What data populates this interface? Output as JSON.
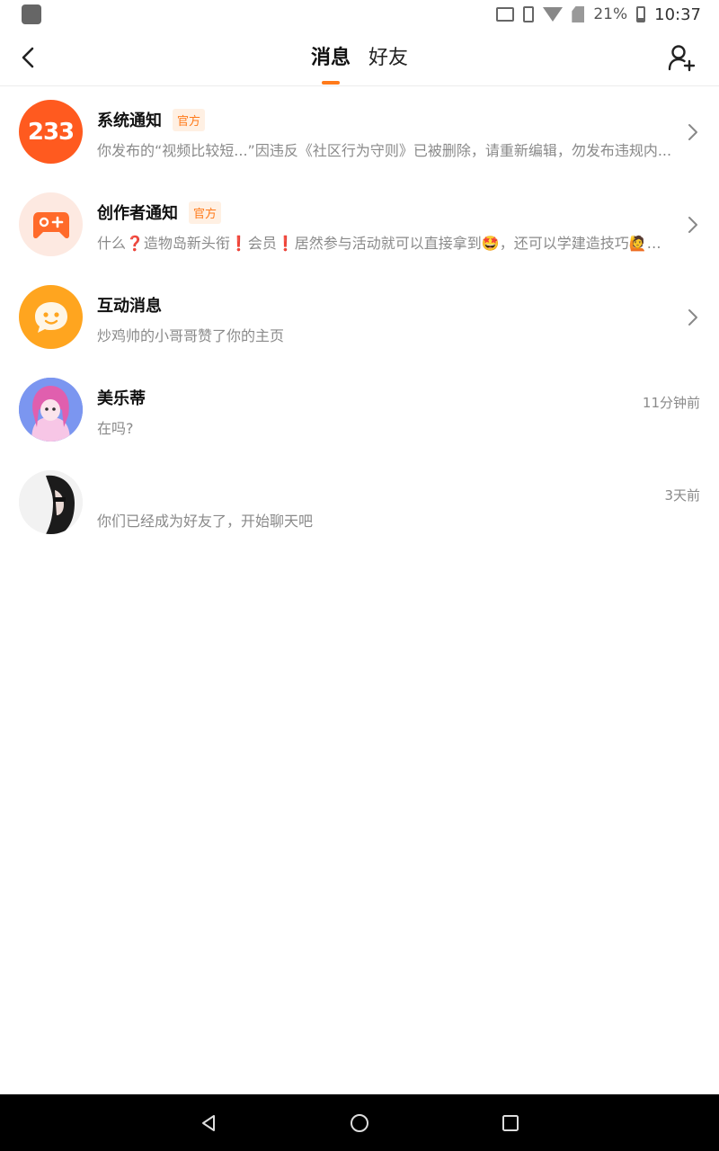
{
  "status_bar": {
    "battery": "21%",
    "time": "10:37",
    "icons": [
      "app-icon",
      "cast-icon",
      "vibrate-icon",
      "wifi-icon",
      "no-sim-icon",
      "battery-icon"
    ]
  },
  "header": {
    "tabs": [
      {
        "label": "消息",
        "active": true
      },
      {
        "label": "好友",
        "active": false
      }
    ],
    "accent": "#ff7a1a"
  },
  "messages": [
    {
      "title": "系统通知",
      "badge": "官方",
      "preview": "你发布的“视频比较短...”因违反《社区行为守则》已被删除，请重新编辑，勿发布违规内...",
      "time": "",
      "avatar_text": "233"
    },
    {
      "title": "创作者通知",
      "badge": "官方",
      "preview": "什么❓造物岛新头衔❗会员❗居然参与活动就可以直接拿到🤩，还可以学建造技巧🙋，...",
      "time": ""
    },
    {
      "title": "互动消息",
      "badge": "",
      "preview": "炒鸡帅的小哥哥赞了你的主页",
      "time": ""
    },
    {
      "title": "美乐蒂",
      "badge": "",
      "preview": "在吗?",
      "time": "11分钟前"
    },
    {
      "title": "",
      "badge": "",
      "preview": "你们已经成为好友了，开始聊天吧",
      "time": "3天前"
    }
  ]
}
